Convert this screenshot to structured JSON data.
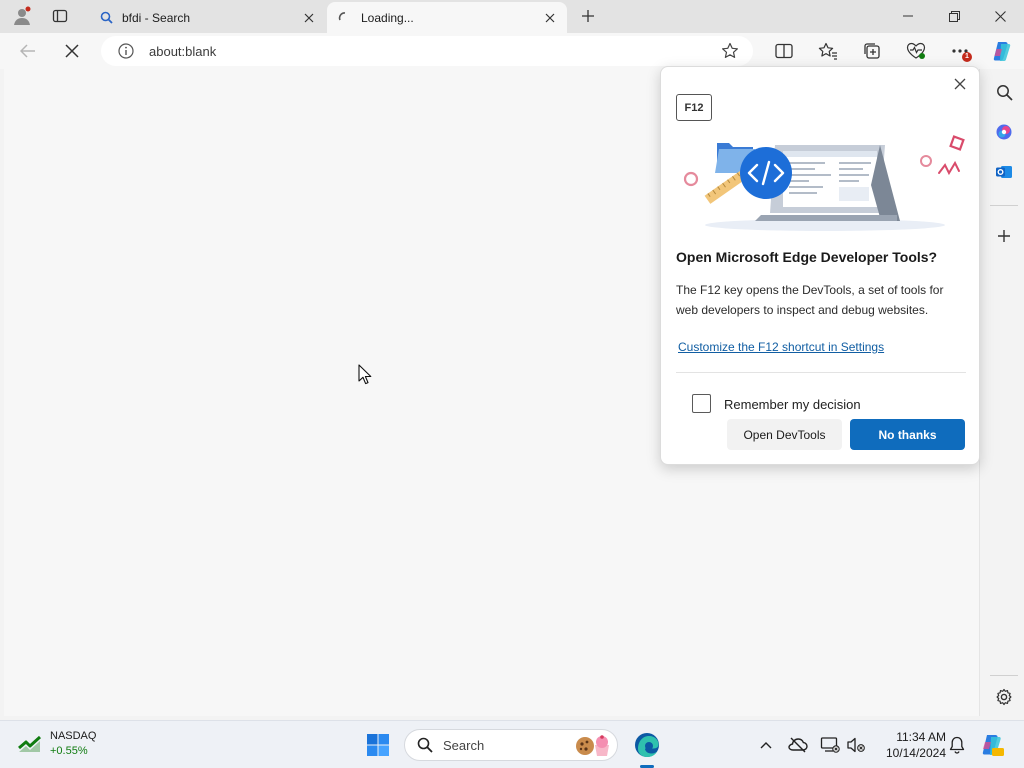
{
  "tabs": [
    {
      "title": "bfdi - Search",
      "favicon": "search-icon"
    },
    {
      "title": "Loading...",
      "favicon": "loading-spinner-icon"
    }
  ],
  "address_bar": {
    "url": "about:blank"
  },
  "toolbar": {
    "extensions_badge": "1"
  },
  "popup": {
    "key_label": "F12",
    "title": "Open Microsoft Edge Developer Tools?",
    "body": "The F12 key opens the DevTools, a set of tools for web developers to inspect and debug websites.",
    "link": "Customize the F12 shortcut in Settings",
    "checkbox_label": "Remember my decision",
    "checkbox_checked": false,
    "open_button": "Open DevTools",
    "no_button": "No thanks"
  },
  "taskbar": {
    "widget": {
      "name": "NASDAQ",
      "value": "+0.55%"
    },
    "search_label": "Search",
    "time": "11:34 AM",
    "date": "10/14/2024"
  },
  "colors": {
    "accent": "#0f6cbd",
    "link": "#115ea3",
    "badge": "#c42b1c",
    "stock_up": "#107c10"
  }
}
